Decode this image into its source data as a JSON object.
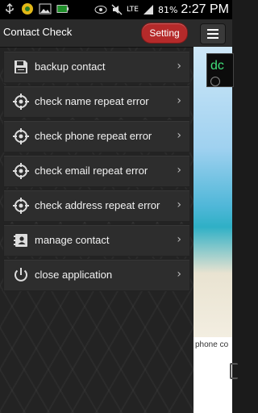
{
  "status_bar": {
    "time": "2:27 PM",
    "battery": "81%",
    "network": "LTE",
    "icons": [
      "usb-icon",
      "android-icon",
      "image-icon",
      "battery-icon",
      "eye-icon",
      "mute-icon",
      "signal-icon"
    ]
  },
  "app_bar": {
    "title": "Contact Check",
    "setting_label": "Setting"
  },
  "menu": {
    "items": [
      {
        "label": "backup contact",
        "icon": "floppy-disk-icon"
      },
      {
        "label": "check name repeat error",
        "icon": "crosshair-icon"
      },
      {
        "label": "check phone repeat error",
        "icon": "crosshair-icon"
      },
      {
        "label": "check email repeat error",
        "icon": "crosshair-icon"
      },
      {
        "label": "check address repeat error",
        "icon": "crosshair-icon"
      },
      {
        "label": "manage contact",
        "icon": "contact-book-icon"
      },
      {
        "label": "close application",
        "icon": "power-icon"
      }
    ],
    "chevron": "›"
  },
  "right_panel": {
    "thumb_text": "dc",
    "partial_text": "phone co"
  },
  "colors": {
    "accent": "#b52a2a",
    "drawer_bg": "#232323",
    "item_bg": "#2d2d2d"
  }
}
